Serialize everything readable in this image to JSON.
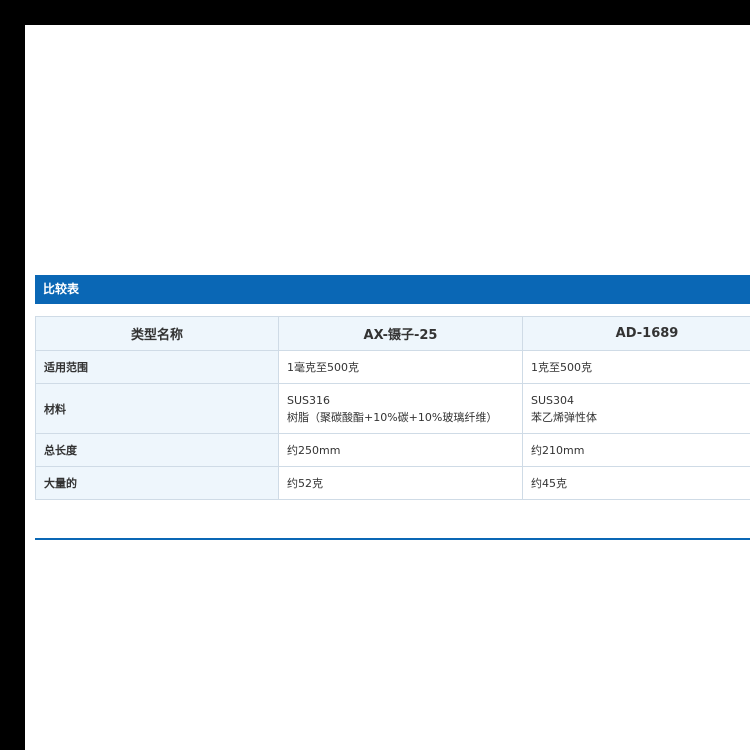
{
  "section": {
    "title": "比较表"
  },
  "table": {
    "headers": [
      "类型名称",
      "AX-镊子-25",
      "AD-1689"
    ],
    "rows": [
      {
        "label": "适用范围",
        "col1": "1毫克至500克",
        "col2": "1克至500克"
      },
      {
        "label": "材料",
        "col1_line1": "SUS316",
        "col1_line2": "树脂（聚碳酸酯+10%碳+10%玻璃纤维）",
        "col2_line1": "SUS304",
        "col2_line2": "苯乙烯弹性体"
      },
      {
        "label": "总长度",
        "col1": "约250mm",
        "col2": "约210mm"
      },
      {
        "label": "大量的",
        "col1": "约52克",
        "col2": "约45克"
      }
    ]
  },
  "colors": {
    "accent": "#0a67b5",
    "header_bg": "#eef6fc",
    "border": "#cfdbe6"
  }
}
